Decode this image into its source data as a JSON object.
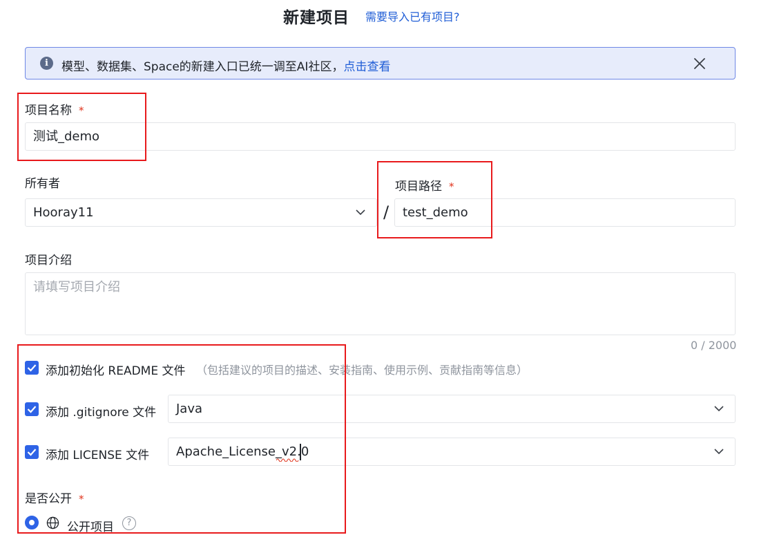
{
  "header": {
    "title": "新建项目",
    "import_link": "需要导入已有项目?"
  },
  "notice": {
    "text": "模型、数据集、Space的新建入口已统一调至AI社区，",
    "link": "点击查看"
  },
  "form": {
    "project_name": {
      "label": "项目名称",
      "required_mark": "*",
      "value": "测试_demo"
    },
    "owner": {
      "label": "所有者",
      "value": "Hooray11"
    },
    "separator": "/",
    "project_path": {
      "label": "项目路径",
      "required_mark": "*",
      "value": "test_demo"
    },
    "description": {
      "label": "项目介绍",
      "placeholder": "请填写项目介绍",
      "counter": "0 / 2000"
    },
    "readme": {
      "checked": true,
      "label": "添加初始化 README 文件",
      "hint": "（包括建议的项目的描述、安装指南、使用示例、贡献指南等信息）"
    },
    "gitignore": {
      "checked": true,
      "label": "添加 .gitignore 文件",
      "value": "Java"
    },
    "license": {
      "checked": true,
      "label": "添加 LICENSE 文件",
      "value": "Apache_License_v2.0"
    },
    "visibility": {
      "label": "是否公开",
      "required_mark": "*",
      "option_label": "公开项目",
      "selected": true
    }
  },
  "colors": {
    "accent": "#2e63e6",
    "link": "#1f5dd6",
    "required": "#e0341d",
    "highlight_box": "#e8191b",
    "notice_bg": "#e7ecfb"
  },
  "icons": [
    "info-icon",
    "close-icon",
    "chevron-down-icon",
    "check-icon",
    "globe-icon",
    "help-icon"
  ]
}
